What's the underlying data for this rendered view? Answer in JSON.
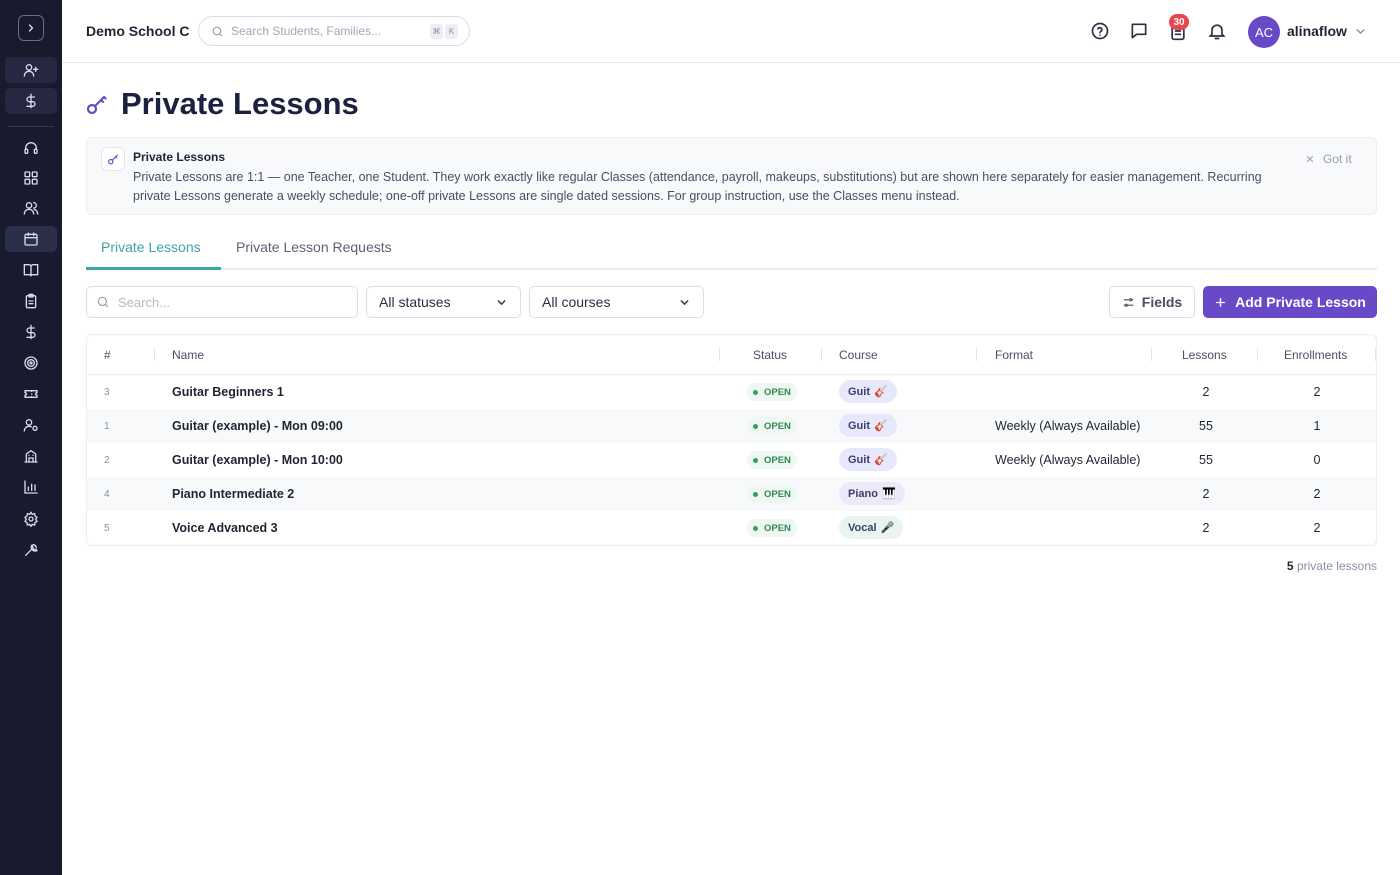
{
  "header": {
    "school_name": "Demo School C",
    "search_placeholder": "Search Students, Families...",
    "shortcut_keys": [
      "⌘",
      "K"
    ],
    "notification_count": "30",
    "user_initials": "AC",
    "user_name": "alinaflow"
  },
  "page": {
    "title": "Private Lessons"
  },
  "info": {
    "title": "Private Lessons",
    "text": "Private Lessons are 1:1 — one Teacher, one Student. They work exactly like regular Classes (attendance, payroll, makeups, substitutions) but are shown here separately for easier management. Recurring private Lessons generate a weekly schedule; one-off private Lessons are single dated sessions. For group instruction, use the Classes menu instead.",
    "dismiss_label": "Got it"
  },
  "tabs": [
    {
      "label": "Private Lessons",
      "active": true
    },
    {
      "label": "Private Lesson Requests",
      "active": false
    }
  ],
  "toolbar": {
    "search_placeholder": "Search...",
    "status_filter": "All statuses",
    "course_filter": "All courses",
    "fields_label": "Fields",
    "add_label": "Add Private Lesson"
  },
  "table": {
    "columns": [
      "#",
      "Name",
      "Status",
      "Course",
      "Format",
      "Lessons",
      "Enrollments"
    ],
    "rows": [
      {
        "id": "3",
        "name": "Guitar Beginners 1",
        "status": "OPEN",
        "course": "Guit",
        "course_emoji": "🎸",
        "format": "",
        "lessons": "2",
        "enrollments": "2"
      },
      {
        "id": "1",
        "name": "Guitar (example) - Mon 09:00",
        "status": "OPEN",
        "course": "Guit",
        "course_emoji": "🎸",
        "format": "Weekly (Always Available)",
        "lessons": "55",
        "enrollments": "1"
      },
      {
        "id": "2",
        "name": "Guitar (example) - Mon 10:00",
        "status": "OPEN",
        "course": "Guit",
        "course_emoji": "🎸",
        "format": "Weekly (Always Available)",
        "lessons": "55",
        "enrollments": "0"
      },
      {
        "id": "4",
        "name": "Piano Intermediate 2",
        "status": "OPEN",
        "course": "Piano",
        "course_emoji": "🎹",
        "format": "",
        "lessons": "2",
        "enrollments": "2"
      },
      {
        "id": "5",
        "name": "Voice Advanced 3",
        "status": "OPEN",
        "course": "Vocal",
        "course_emoji": "🎤",
        "format": "",
        "lessons": "2",
        "enrollments": "2"
      }
    ],
    "chip_colors": {
      "Guit": "#e7e8fb",
      "Piano": "#efe8f8",
      "Vocal": "#eaf4ef"
    }
  },
  "footer": {
    "count": "5",
    "count_label": "private lessons"
  },
  "colors": {
    "brand": "#6a49c8",
    "tab_accent": "#3fa4a6",
    "sidebar_bg": "#181a2e",
    "badge": "#e5484d",
    "status_open": "#2f8a53"
  }
}
